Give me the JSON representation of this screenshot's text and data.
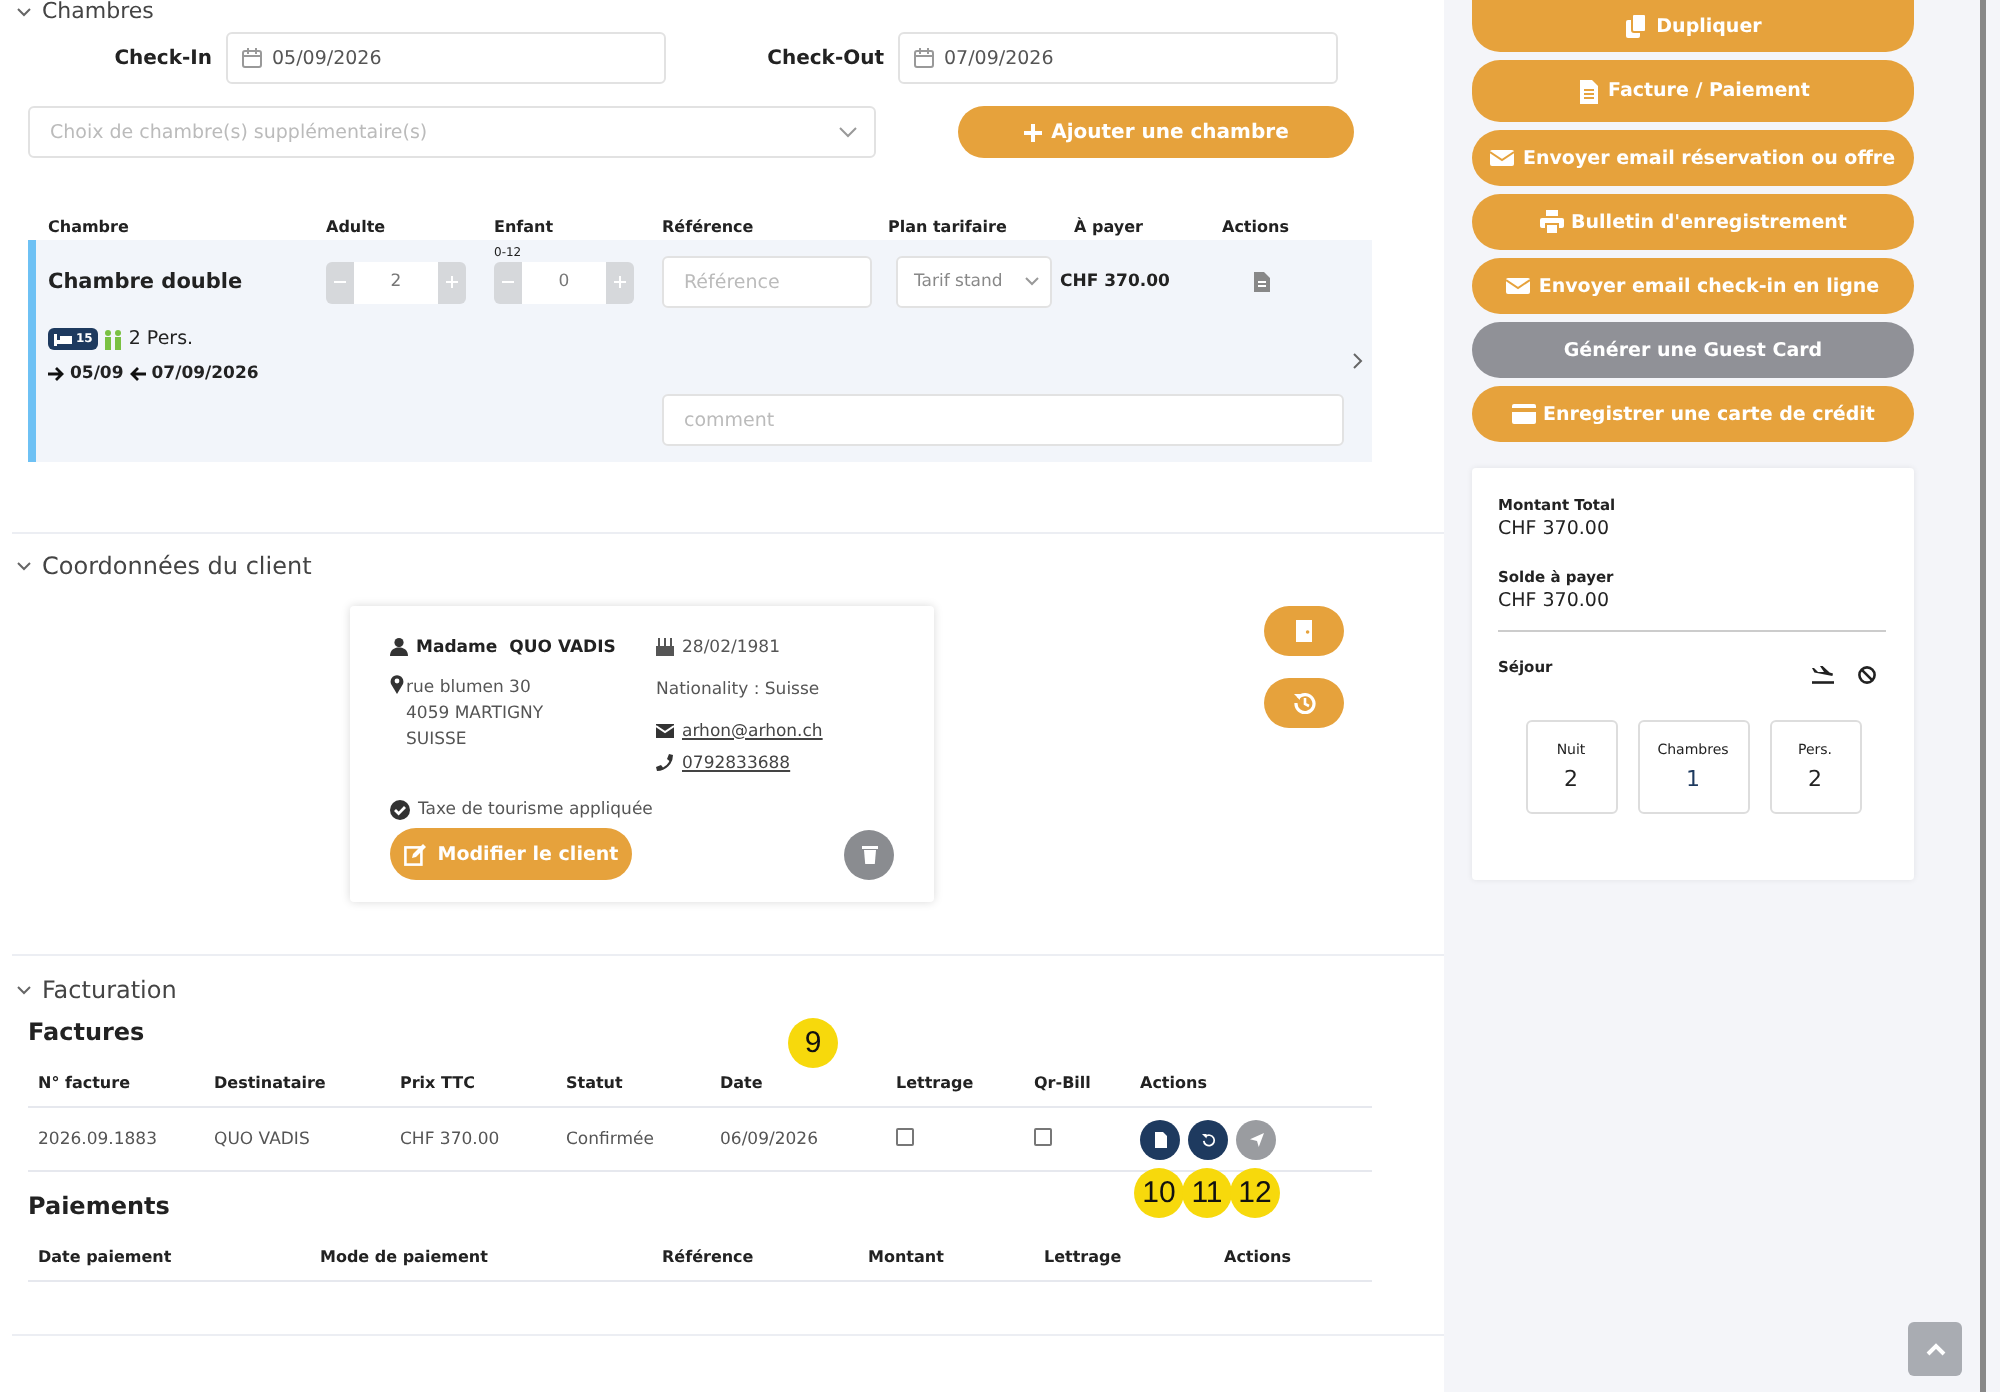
{
  "chambres": {
    "title": "Chambres",
    "expanded": true,
    "check_in": {
      "label": "Check-In",
      "value": "05/09/2026"
    },
    "check_out": {
      "label": "Check-Out",
      "value": "07/09/2026"
    },
    "room_select": {
      "placeholder": "Choix de chambre(s) supplémentaire(s)"
    },
    "add_button": "Ajouter une chambre",
    "table": {
      "columns": [
        "Chambre",
        "Adulte",
        "Enfant",
        "Référence",
        "Plan tarifaire",
        "À payer",
        "Actions"
      ],
      "rows": [
        {
          "name": "Chambre double",
          "adults": "2",
          "children": "0",
          "children_range": "0-12",
          "reference": {
            "placeholder": "Référence"
          },
          "rate_plan": "Tarif stand",
          "amount": "CHF 370.00",
          "room_number": "15",
          "persons": "2 Pers.",
          "arrival": "05/09",
          "departure": "07/09/2026",
          "comment": {
            "placeholder": "comment"
          }
        }
      ]
    }
  },
  "client": {
    "title": "Coordonnées du client",
    "expanded": true,
    "salutation": "Madame",
    "name": "QUO VADIS",
    "address": [
      "rue blumen 30",
      "4059 MARTIGNY",
      "SUISSE"
    ],
    "birth_date": "28/02/1981",
    "nationality": "Nationality : Suisse",
    "email": "arhon@arhon.ch",
    "phone": "0792833688",
    "tourist_tax": {
      "label": "Taxe de tourisme appliquée",
      "checked": true
    },
    "edit_button": "Modifier le client"
  },
  "facturation": {
    "title": "Facturation",
    "expanded": true,
    "invoices": {
      "title": "Factures",
      "marker": "9",
      "columns": [
        "N° facture",
        "Destinataire",
        "Prix TTC",
        "Statut",
        "Date",
        "Lettrage",
        "Qr-Bill",
        "Actions"
      ],
      "rows": [
        {
          "number": "2026.09.1883",
          "recipient": "QUO VADIS",
          "price": "CHF 370.00",
          "status": "Confirmée",
          "date": "06/09/2026",
          "lettrage": false,
          "qr_bill": false,
          "actions": [
            {
              "kind": "document",
              "disabled": false,
              "marker": "10"
            },
            {
              "kind": "undo",
              "disabled": false,
              "marker": "11"
            },
            {
              "kind": "send",
              "disabled": true,
              "marker": "12"
            }
          ]
        }
      ]
    },
    "payments": {
      "title": "Paiements",
      "columns": [
        "Date paiement",
        "Mode de paiement",
        "Référence",
        "Montant",
        "Lettrage",
        "Actions"
      ]
    }
  },
  "sidebar": {
    "actions": [
      {
        "label": "Dupliquer",
        "kind": "copy",
        "disabled": false
      },
      {
        "label": "Facture / Paiement",
        "kind": "invoice",
        "disabled": false
      },
      {
        "label": "Envoyer email réservation ou offre",
        "kind": "mail",
        "disabled": false
      },
      {
        "label": "Bulletin d'enregistrement",
        "kind": "print",
        "disabled": false
      },
      {
        "label": "Envoyer email check-in en ligne",
        "kind": "mail",
        "disabled": false
      },
      {
        "label": "Générer une Guest Card",
        "kind": "plain",
        "disabled": true
      },
      {
        "label": "Enregistrer une carte de crédit",
        "kind": "card",
        "disabled": false
      }
    ],
    "summary": {
      "total_label": "Montant Total",
      "total": "CHF 370.00",
      "balance_label": "Solde à payer",
      "balance": "CHF 370.00",
      "stay_label": "Séjour",
      "stats": [
        {
          "label": "Nuit",
          "value": "2"
        },
        {
          "label": "Chambres",
          "value": "1"
        },
        {
          "label": "Pers.",
          "value": "2"
        }
      ]
    }
  }
}
